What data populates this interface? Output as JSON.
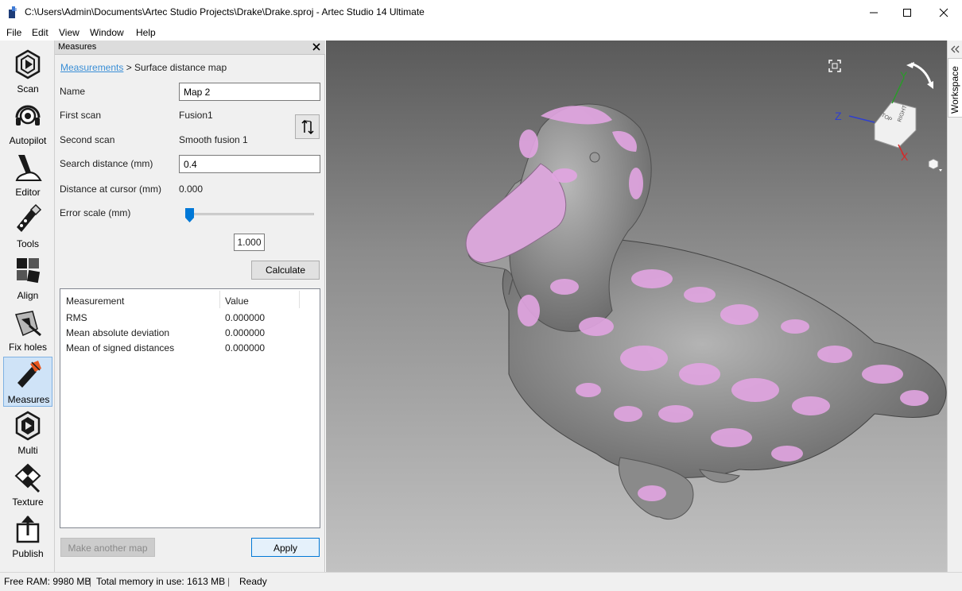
{
  "window": {
    "title": "C:\\Users\\Admin\\Documents\\Artec Studio Projects\\Drake\\Drake.sproj - Artec Studio 14 Ultimate"
  },
  "menu": [
    "File",
    "Edit",
    "View",
    "Window",
    "Help"
  ],
  "toolbar": {
    "items": [
      {
        "label": "Scan",
        "icon": "scan-icon"
      },
      {
        "label": "Autopilot",
        "icon": "autopilot-icon"
      },
      {
        "label": "Editor",
        "icon": "editor-icon"
      },
      {
        "label": "Tools",
        "icon": "tools-icon"
      },
      {
        "label": "Align",
        "icon": "align-icon"
      },
      {
        "label": "Fix holes",
        "icon": "fix-holes-icon"
      },
      {
        "label": "Measures",
        "icon": "measures-icon"
      },
      {
        "label": "Multi",
        "icon": "multi-icon"
      },
      {
        "label": "Texture",
        "icon": "texture-icon"
      },
      {
        "label": "Publish",
        "icon": "publish-icon"
      }
    ],
    "active": "Measures"
  },
  "panel": {
    "title": "Measures",
    "breadcrumb_link": "Measurements",
    "breadcrumb_rest": " > Surface distance map",
    "name_label": "Name",
    "name_value": "Map 2",
    "first_scan_label": "First scan",
    "first_scan_value": "Fusion1",
    "second_scan_label": "Second scan",
    "second_scan_value": "Smooth fusion 1",
    "search_distance_label": "Search distance (mm)",
    "search_distance_value": "0.4",
    "distance_cursor_label": "Distance at cursor (mm)",
    "distance_cursor_value": "0.000",
    "error_scale_label": "Error scale (mm)",
    "error_scale_value": "1.000",
    "error_scale_slider_fraction": 0.0,
    "calculate_label": "Calculate",
    "table": {
      "headers": [
        "Measurement",
        "Value"
      ],
      "rows": [
        {
          "measurement": "RMS",
          "value": "0.000000"
        },
        {
          "measurement": "Mean absolute deviation",
          "value": "0.000000"
        },
        {
          "measurement": "Mean of signed distances",
          "value": "0.000000"
        }
      ]
    },
    "make_another_label": "Make another map",
    "apply_label": "Apply"
  },
  "viewport": {
    "gizmo": {
      "x": "X",
      "y": "Y",
      "z": "Z",
      "top": "TOP",
      "right": "RIGHT"
    },
    "colors": {
      "surface": "#8a8a8a",
      "deviation": "#e7a6e7"
    }
  },
  "workspace_label": "Workspace",
  "status": {
    "free_ram": "Free RAM: 9980 MB",
    "total_memory": "Total memory in use: 1613 MB",
    "state": "Ready"
  }
}
